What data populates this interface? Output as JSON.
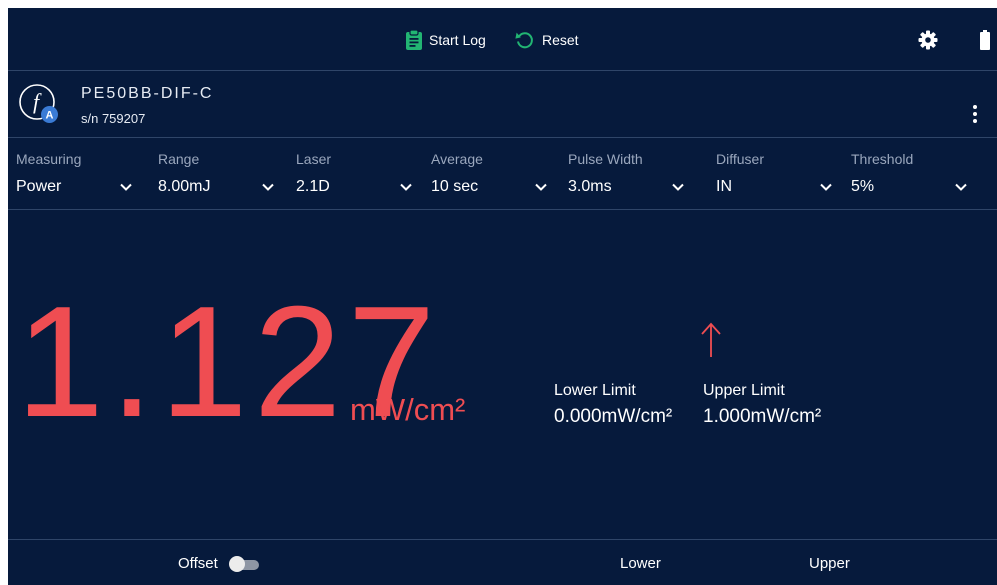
{
  "colors": {
    "background": "#061a3c",
    "reading": "#ef4d52",
    "accent_green": "#22b573",
    "sensor_badge": "#3a7bd5",
    "divider": "#2f4568"
  },
  "toolbar": {
    "start_log_label": "Start Log",
    "start_log_icon": "clipboard-icon",
    "reset_label": "Reset",
    "reset_icon": "reset-icon",
    "settings_icon": "gear-icon",
    "battery_icon": "battery-icon"
  },
  "device": {
    "logo_letter": "f",
    "logo_badge": "A",
    "model": "PE50BB-DIF-C",
    "serial": "s/n 759207",
    "menu_icon": "more-vertical-icon"
  },
  "settings": [
    {
      "label": "Measuring",
      "value": "Power"
    },
    {
      "label": "Range",
      "value": "8.00mJ"
    },
    {
      "label": "Laser",
      "value": "2.1D"
    },
    {
      "label": "Average",
      "value": "10 sec"
    },
    {
      "label": "Pulse Width",
      "value": "3.0ms"
    },
    {
      "label": "Diffuser",
      "value": "IN"
    },
    {
      "label": "Threshold",
      "value": "5%"
    }
  ],
  "reading": {
    "value": "1.127",
    "unit": "mW/cm²",
    "indicator_icon": "arrow-up-icon"
  },
  "limits": {
    "lower_title": "Lower Limit",
    "lower_value": "0.000mW/cm²",
    "upper_title": "Upper Limit",
    "upper_value": "1.000mW/cm²"
  },
  "bottom": {
    "offset_label": "Offset",
    "offset_on": false,
    "lower_label": "Lower",
    "upper_label": "Upper"
  }
}
